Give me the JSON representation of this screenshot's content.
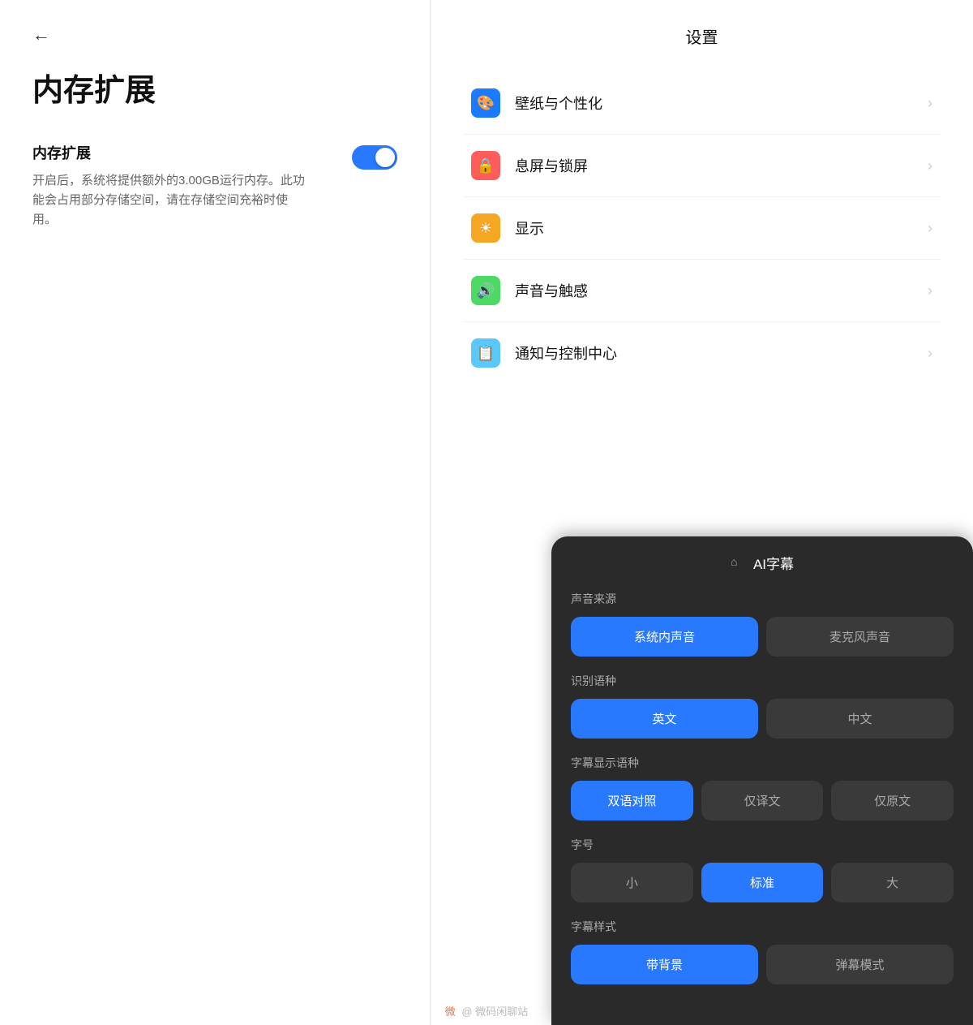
{
  "left": {
    "back_label": "←",
    "page_title": "内存扩展",
    "section_title": "内存扩展",
    "section_desc": "开启后，系统将提供额外的3.00GB运行内存。此功能会占用部分存储空间，请在存储空间充裕时使用。",
    "toggle_state": true
  },
  "right": {
    "settings_header": "设置",
    "items": [
      {
        "label": "壁纸与个性化",
        "icon_type": "blue",
        "icon": "🎨"
      },
      {
        "label": "息屏与锁屏",
        "icon_type": "red",
        "icon": "🔒"
      },
      {
        "label": "显示",
        "icon_type": "yellow",
        "icon": "☀"
      },
      {
        "label": "声音与触感",
        "icon_type": "green",
        "icon": "🔊"
      },
      {
        "label": "通知与控制中心",
        "icon_type": "teal",
        "icon": "📋"
      }
    ]
  },
  "overlay": {
    "title": "AI字幕",
    "sound_source_label": "声音来源",
    "sound_source_options": [
      "系统内声音",
      "麦克风声音"
    ],
    "sound_source_active": 0,
    "language_label": "识别语种",
    "language_options": [
      "英文",
      "中文"
    ],
    "language_active": 0,
    "display_lang_label": "字幕显示语种",
    "display_lang_options": [
      "双语对照",
      "仅译文",
      "仅原文"
    ],
    "display_lang_active": 0,
    "font_size_label": "字号",
    "font_size_options": [
      "小",
      "标准",
      "大"
    ],
    "font_size_active": 1,
    "style_label": "字幕样式",
    "style_options": [
      "带背景",
      "弹幕模式"
    ],
    "style_active": 0
  },
  "watermark": "微码闲聊站"
}
